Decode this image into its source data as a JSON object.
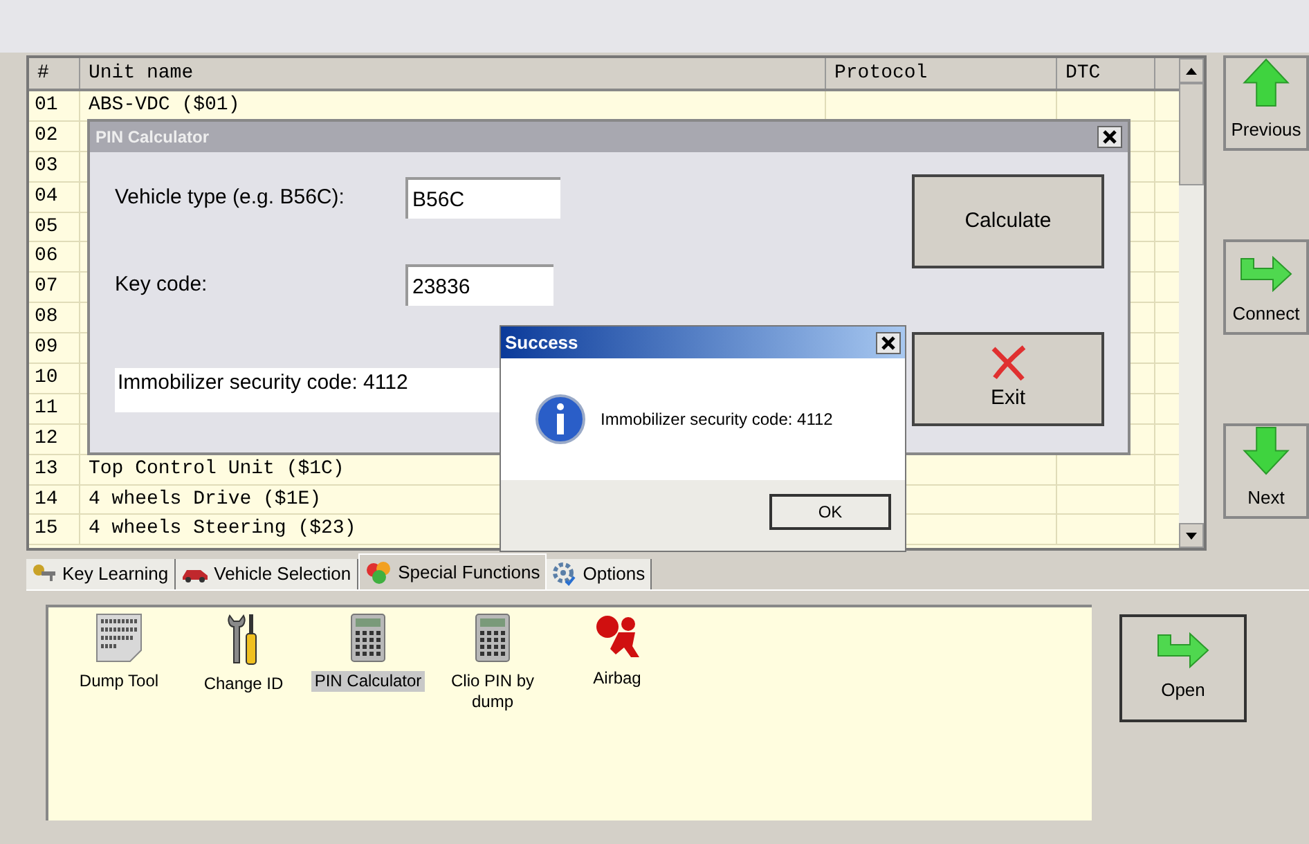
{
  "table": {
    "columns": [
      "#",
      "Unit name",
      "Protocol",
      "DTC"
    ],
    "rows": [
      {
        "number": "01",
        "unit_name": "ABS-VDC ($01)"
      },
      {
        "number": "02"
      },
      {
        "number": "03"
      },
      {
        "number": "04"
      },
      {
        "number": "05"
      },
      {
        "number": "06"
      },
      {
        "number": "07"
      },
      {
        "number": "08"
      },
      {
        "number": "09"
      },
      {
        "number": "10"
      },
      {
        "number": "11"
      },
      {
        "number": "12"
      },
      {
        "number": "13",
        "unit_name": "Top Control Unit ($1C)"
      },
      {
        "number": "14",
        "unit_name": "4 wheels Drive ($1E)"
      },
      {
        "number": "15",
        "unit_name": "4 wheels Steering ($23)"
      }
    ]
  },
  "nav_buttons": [
    {
      "label": "Previous",
      "kind": "up"
    },
    {
      "label": "Connect",
      "kind": "right"
    },
    {
      "label": "Next",
      "kind": "down"
    }
  ],
  "tabs": [
    {
      "label": "Key Learning",
      "selected": false,
      "kind": "key"
    },
    {
      "label": "Vehicle Selection",
      "selected": false,
      "kind": "car"
    },
    {
      "label": "Special Functions",
      "selected": true,
      "kind": "hearts"
    },
    {
      "label": "Options",
      "selected": false,
      "kind": "gear"
    }
  ],
  "functions": [
    {
      "label": "Dump Tool",
      "kind": "binary",
      "selected": false
    },
    {
      "label": "Change ID",
      "kind": "tools",
      "selected": false
    },
    {
      "label": "PIN Calculator",
      "kind": "calculator",
      "selected": true
    },
    {
      "label": "Clio PIN by dump",
      "kind": "calculator",
      "selected": false
    },
    {
      "label": "Airbag",
      "kind": "airbag",
      "selected": false
    }
  ],
  "open_button": {
    "label": "Open"
  },
  "pin_dialog": {
    "title": "PIN Calculator",
    "vehicle_label": "Vehicle type (e.g. B56C):",
    "vehicle_value": "B56C",
    "key_label": "Key code:",
    "key_value": "23836",
    "result": "Immobilizer security code: 4112",
    "calculate": "Calculate",
    "exit": "Exit"
  },
  "success_dialog": {
    "title": "Success",
    "message": "Immobilizer security code: 4112",
    "ok": "OK"
  }
}
